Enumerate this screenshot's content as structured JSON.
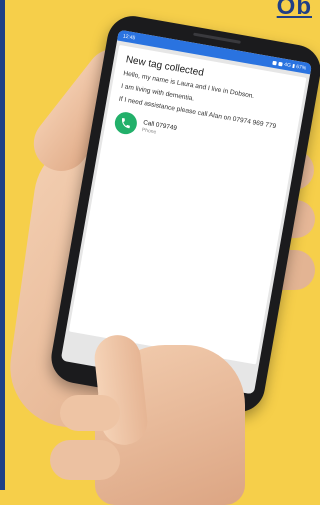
{
  "poster": {
    "corner_title": "Ob"
  },
  "phone": {
    "status_bar": {
      "time": "12:45",
      "right": "4G ▮ 67%"
    },
    "notification": {
      "title": "New tag collected",
      "line_1": "Hello, my name is Laura and I live in Dobson.",
      "line_2": "I am living with dementia.",
      "line_3": "If I need assistance please call Alan on 07974 969 779",
      "call_label": "Call 079749",
      "call_sub": "Phone"
    }
  },
  "colors": {
    "background": "#f6cf4a",
    "accent": "#1f3f86",
    "status_bar": "#2a73e0",
    "call_button": "#22b06a"
  },
  "icons": {
    "call": "phone-icon"
  }
}
